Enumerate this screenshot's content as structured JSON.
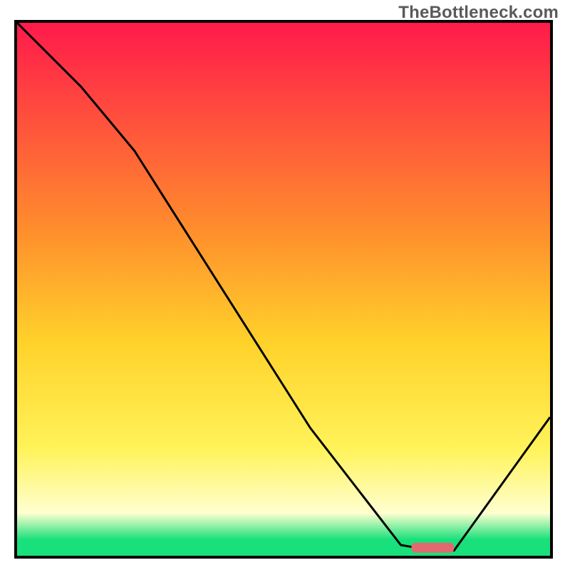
{
  "watermark": "TheBottleneck.com",
  "colors": {
    "border": "#000000",
    "curve": "#000000",
    "marker": "#e26a6e",
    "grad_top": "#ff1a4b",
    "grad_mid_high": "#ff8b2d",
    "grad_mid": "#ffd22a",
    "grad_mid_low": "#fff35a",
    "grad_low": "#ffffd0",
    "grad_bottom": "#18e07a"
  },
  "chart_data": {
    "type": "line",
    "title": "",
    "xlabel": "",
    "ylabel": "",
    "xlim": [
      0,
      100
    ],
    "ylim": [
      0,
      100
    ],
    "series": [
      {
        "name": "curve",
        "x": [
          0,
          12,
          22,
          55,
          72,
          78,
          82,
          100
        ],
        "y": [
          100,
          88,
          76,
          24,
          2,
          1,
          1,
          26
        ]
      }
    ],
    "annotations": [
      {
        "name": "marker",
        "x": 78,
        "y": 1.5,
        "shape": "rounded-bar"
      }
    ],
    "gradient_stops_pct": [
      {
        "offset": 0,
        "key": "grad_top"
      },
      {
        "offset": 38,
        "key": "grad_mid_high"
      },
      {
        "offset": 60,
        "key": "grad_mid"
      },
      {
        "offset": 80,
        "key": "grad_mid_low"
      },
      {
        "offset": 92,
        "key": "grad_low"
      },
      {
        "offset": 97,
        "key": "grad_bottom"
      },
      {
        "offset": 100,
        "key": "grad_bottom"
      }
    ]
  }
}
